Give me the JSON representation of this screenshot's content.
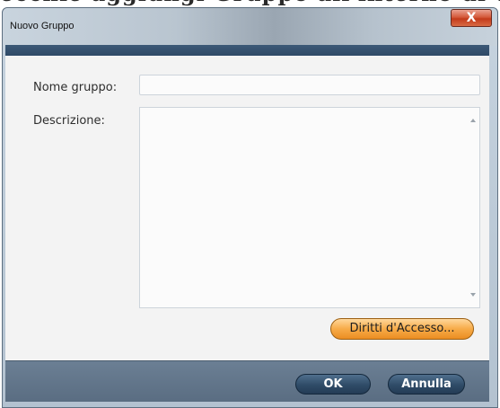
{
  "background": {
    "cropped_text": "ecchie aggiungi Gruppo all'interno di unità"
  },
  "window": {
    "title": "Nuovo Gruppo",
    "close_glyph": "X"
  },
  "form": {
    "name_label": "Nome gruppo:",
    "name_value": "",
    "description_label": "Descrizione:",
    "description_value": ""
  },
  "buttons": {
    "access_rights": "Diritti d'Accesso...",
    "ok": "OK",
    "cancel": "Annulla"
  },
  "colors": {
    "accent_orange": "#f7ab48",
    "button_navy": "#2f4b67",
    "header_band": "#3c5977",
    "close_red": "#c33a1b"
  },
  "icons": [
    "close-icon",
    "scroll-up-arrow-icon",
    "scroll-down-arrow-icon"
  ]
}
